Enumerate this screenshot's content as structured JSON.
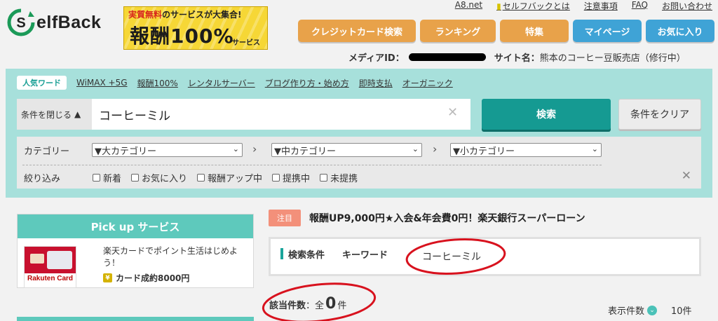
{
  "logo": {
    "text": "elfBack",
    "mark_letter": "S"
  },
  "banner": {
    "line1_pre": "実質無料",
    "line1_post": "のサービスが大集合!",
    "main": "報酬100%",
    "sub": "サービス"
  },
  "top_links": [
    "A8.net",
    "セルフバックとは",
    "注意事項",
    "FAQ",
    "お問い合わせ"
  ],
  "nav_buttons": [
    {
      "label": "クレジットカード検索",
      "color": "orange"
    },
    {
      "label": "ランキング",
      "color": "orange"
    },
    {
      "label": "特集",
      "color": "orange"
    },
    {
      "label": "マイページ",
      "color": "blue"
    },
    {
      "label": "お気に入り",
      "color": "blue"
    }
  ],
  "media": {
    "id_label": "メディアID：",
    "site_label": "サイト名：",
    "site_name": "熊本のコーヒー豆販売店（修行中）"
  },
  "popular": {
    "tag": "人気ワード",
    "words": [
      "WiMAX +5G",
      "報酬100%",
      "レンタルサーバー",
      "ブログ作り方・始め方",
      "即時支払",
      "オーガニック"
    ]
  },
  "search": {
    "toggle_label": "条件を閉じる",
    "toggle_icon": "▲",
    "query": "コーヒーミル",
    "clear_icon": "✕",
    "submit_label": "検索",
    "reset_label": "条件をクリア"
  },
  "filters": {
    "category_label": "カテゴリー",
    "large": "▼大カテゴリー",
    "medium": "▼中カテゴリー",
    "small": "▼小カテゴリー",
    "narrow_label": "絞り込み",
    "checks": [
      "新着",
      "お気に入り",
      "報酬アップ中",
      "提携中",
      "未提携"
    ],
    "close_icon": "✕"
  },
  "pickup": {
    "title": "Pick up サービス",
    "card_logo": "Rakuten Card",
    "text": "楽天カードでポイント生活はじめよう！",
    "price": "カード成約8000円"
  },
  "notice": {
    "tag": "注目",
    "text": "報酬UP9,000円★入会&年会費0円！楽天銀行スーパーローン"
  },
  "condition": {
    "label": "検索条件",
    "keyword_label": "キーワード",
    "keyword_value": "コーヒーミル"
  },
  "results": {
    "label": "該当件数",
    "sep": "：全",
    "count": "0",
    "unit": "件",
    "display_label": "表示件数",
    "display_value": "10件"
  },
  "colors": {
    "teal": "#159a92",
    "panel": "#a7e0db",
    "orange": "#e8a24a",
    "blue": "#3fa3d6",
    "annotation_red": "#d8121e"
  }
}
